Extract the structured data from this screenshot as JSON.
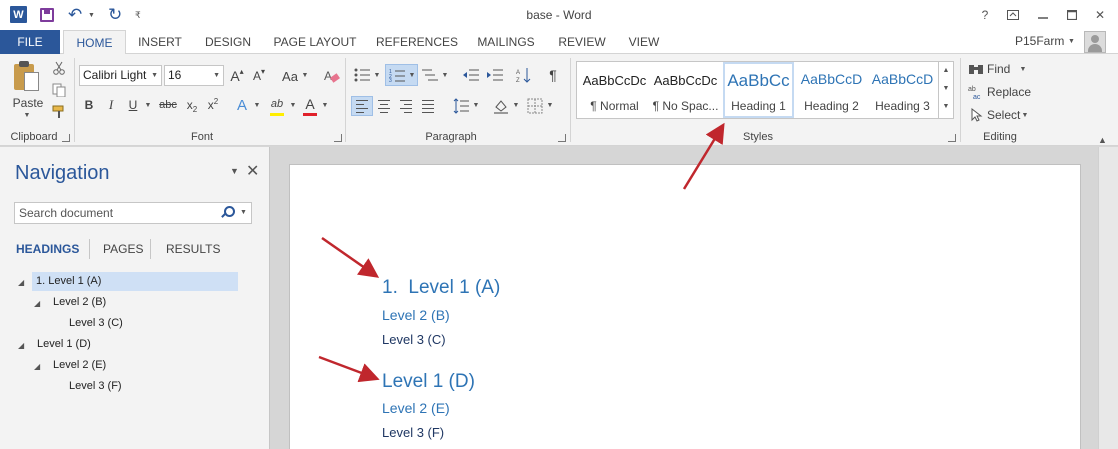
{
  "window": {
    "title": "base - Word",
    "app_icon": "W",
    "account_name": "P15Farm",
    "help": "?"
  },
  "tabs": [
    "FILE",
    "HOME",
    "INSERT",
    "DESIGN",
    "PAGE LAYOUT",
    "REFERENCES",
    "MAILINGS",
    "REVIEW",
    "VIEW"
  ],
  "ribbon": {
    "clipboard": {
      "paste_label": "Paste",
      "group_label": "Clipboard"
    },
    "font": {
      "font_name": "Calibri Light",
      "font_size": "16",
      "grow": "A",
      "shrink": "A",
      "case": "Aa",
      "bold": "B",
      "italic": "I",
      "underline": "U",
      "strike": "abc",
      "sub": "x",
      "sub_mark": "2",
      "sup": "x",
      "sup_mark": "2",
      "effects": "A",
      "highlight": "ab",
      "color": "A",
      "group_label": "Font"
    },
    "paragraph": {
      "group_label": "Paragraph",
      "pilcrow": "¶"
    },
    "styles": {
      "group_label": "Styles",
      "items": [
        {
          "sample": "AaBbCcDc",
          "name": "¶ Normal"
        },
        {
          "sample": "AaBbCcDc",
          "name": "¶ No Spac..."
        },
        {
          "sample": "AaBbCc",
          "name": "Heading 1"
        },
        {
          "sample": "AaBbCcD",
          "name": "Heading 2"
        },
        {
          "sample": "AaBbCcD",
          "name": "Heading 3"
        }
      ],
      "active_index": 2
    },
    "editing": {
      "group_label": "Editing",
      "find": "Find",
      "replace": "Replace",
      "select": "Select"
    }
  },
  "navigation": {
    "title": "Navigation",
    "search_placeholder": "Search document",
    "tabs": [
      "HEADINGS",
      "PAGES",
      "RESULTS"
    ],
    "active_tab": "HEADINGS",
    "tree": [
      {
        "label": "1. Level 1 (A)",
        "level": 1,
        "selected": true
      },
      {
        "label": "Level 2 (B)",
        "level": 2,
        "selected": false
      },
      {
        "label": "Level 3 (C)",
        "level": 3,
        "selected": false
      },
      {
        "label": "Level 1 (D)",
        "level": 1,
        "selected": false
      },
      {
        "label": "Level 2 (E)",
        "level": 2,
        "selected": false
      },
      {
        "label": "Level 3 (F)",
        "level": 3,
        "selected": false
      }
    ]
  },
  "document": {
    "headings": [
      {
        "number": "1.",
        "text": "Level 1 (A)",
        "style": "Heading 1"
      },
      {
        "text": "Level 2 (B)",
        "style": "Heading 2"
      },
      {
        "text": "Level 3 (C)",
        "style": "Heading 3"
      },
      {
        "text": "Level 1 (D)",
        "style": "Heading 1"
      },
      {
        "text": "Level 2 (E)",
        "style": "Heading 2"
      },
      {
        "text": "Level 3 (F)",
        "style": "Heading 3"
      }
    ]
  },
  "colors": {
    "word_blue": "#2b579a",
    "heading_blue": "#2e74b5",
    "heading3_navy": "#1f3763",
    "annotation_arrow": "#c0272d"
  }
}
